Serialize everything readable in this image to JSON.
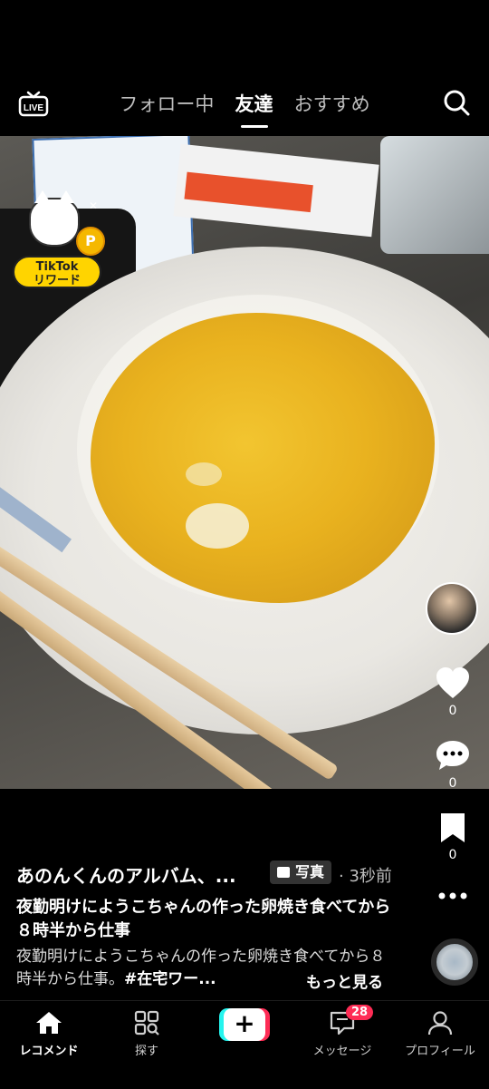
{
  "top": {
    "live_label": "LIVE",
    "tabs": [
      {
        "label": "フォロー中",
        "active": false
      },
      {
        "label": "友達",
        "active": true
      },
      {
        "label": "おすすめ",
        "active": false
      }
    ]
  },
  "reward": {
    "coin_letter": "P",
    "line1": "TikTok",
    "line2": "リワード"
  },
  "rail": {
    "likes": "0",
    "comments": "0",
    "bookmarks": "0"
  },
  "post": {
    "username": "あのんくんのアルバム、...",
    "type_badge": "写真",
    "time": "· 3秒前",
    "title": "夜勤明けにようこちゃんの作った卵焼き食べてから８時半から仕事",
    "desc_text": "夜勤明けにようこちゃんの作った卵焼き食べてから８時半から仕事。",
    "desc_tag": "#在宅ワー...",
    "more": "もっと見る"
  },
  "nav": {
    "home": "レコメンド",
    "explore": "探す",
    "plus": "+",
    "inbox": "メッセージ",
    "inbox_badge": "28",
    "profile": "プロフィール"
  },
  "colors": {
    "accent_red": "#fe2c55",
    "accent_cyan": "#25f4ee",
    "reward_yellow": "#ffd400"
  }
}
